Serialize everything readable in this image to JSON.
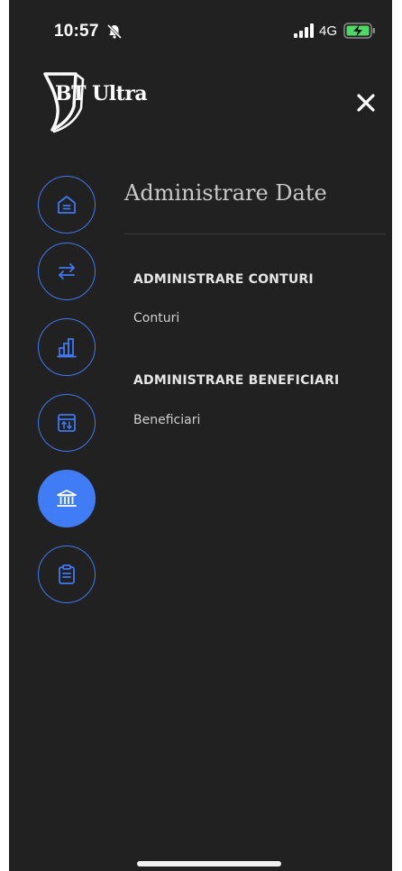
{
  "status_bar": {
    "time": "10:57",
    "network": "4G",
    "icons": [
      "bell-slash-icon",
      "signal-icon",
      "battery-charging-icon"
    ]
  },
  "header": {
    "logo_text": "BT Ultra",
    "close_icon": "close-icon"
  },
  "side_nav": {
    "items": [
      {
        "icon": "home-icon",
        "active": false
      },
      {
        "icon": "transfer-arrows-icon",
        "active": false
      },
      {
        "icon": "bar-chart-icon",
        "active": false
      },
      {
        "icon": "exchange-calendar-icon",
        "active": false
      },
      {
        "icon": "bank-icon",
        "active": true
      },
      {
        "icon": "clipboard-icon",
        "active": false
      }
    ]
  },
  "main": {
    "title": "Administrare Date",
    "groups": [
      {
        "heading": "ADMINISTRARE CONTURI",
        "link": "Conturi"
      },
      {
        "heading": "ADMINISTRARE BENEFICIARI",
        "link": "Beneficiari"
      }
    ]
  },
  "colors": {
    "background": "#212121",
    "accent": "#3f7cf5",
    "text_primary": "#e6e6e6",
    "text_secondary": "#c9c9c9"
  }
}
